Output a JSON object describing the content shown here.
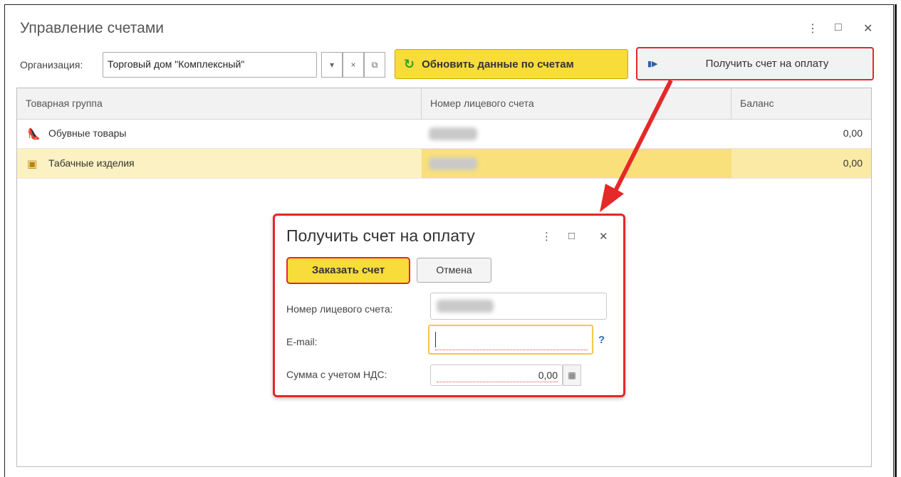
{
  "window": {
    "title": "Управление счетами",
    "more_glyph": "⋮",
    "maximize_glyph": "□",
    "close_glyph": "✕"
  },
  "toolbar": {
    "org_label": "Организация:",
    "org_value": "Торговый дом \"Комплексный\"",
    "dropdown_glyph": "▾",
    "clear_glyph": "×",
    "open_glyph": "⧉",
    "refresh_label": "Обновить данные по счетам",
    "refresh_icon": "↻",
    "get_invoice_label": "Получить счет на оплату",
    "get_invoice_icon": "▮▶"
  },
  "table": {
    "columns": [
      "Товарная группа",
      "Номер лицевого счета",
      "Баланс"
    ],
    "rows": [
      {
        "group": "Обувные товары",
        "icon": "shoe-icon",
        "glyph": "👠",
        "balance": "0,00",
        "selected": false
      },
      {
        "group": "Табачные изделия",
        "icon": "tobacco-icon",
        "glyph": "▣",
        "balance": "0,00",
        "selected": true
      }
    ]
  },
  "dialog": {
    "title": "Получить счет на оплату",
    "order_button": "Заказать счет",
    "cancel_button": "Отмена",
    "account_label": "Номер лицевого счета:",
    "account_value": "",
    "email_label": "E-mail:",
    "email_value": "",
    "help_glyph": "?",
    "amount_label": "Сумма с учетом НДС:",
    "amount_value": "0,00",
    "calc_glyph": "▦"
  },
  "colors": {
    "accent_yellow": "#f7dc3a",
    "highlight_red": "#e52828",
    "selected_row": "#fcf1c2"
  }
}
